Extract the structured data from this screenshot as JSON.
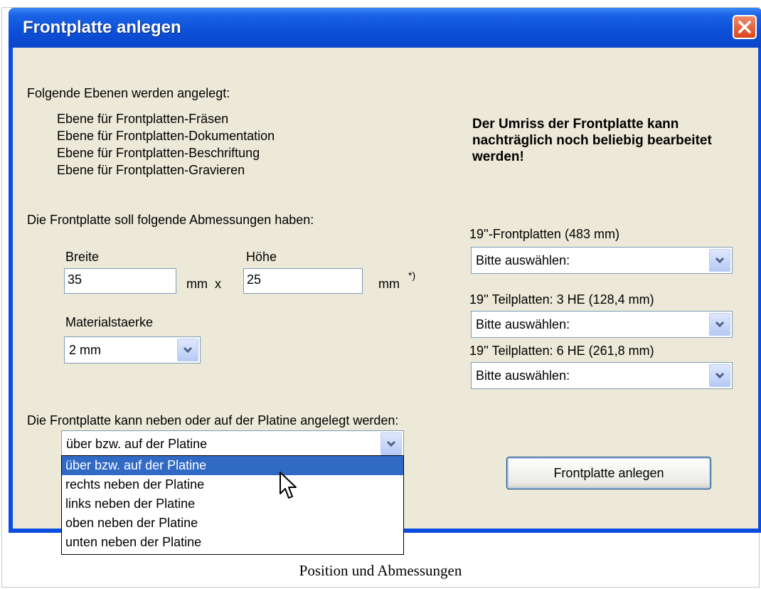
{
  "window": {
    "title": "Frontplatte anlegen"
  },
  "layers": {
    "heading": "Folgende Ebenen werden angelegt:",
    "items": [
      "Ebene für Frontplatten-Fräsen",
      "Ebene für Frontplatten-Dokumentation",
      "Ebene für Frontplatten-Beschriftung",
      "Ebene für Frontplatten-Gravieren"
    ]
  },
  "note": "Der Umriss der Frontplatte kann nachträglich noch beliebig bearbeitet werden!",
  "dimensions": {
    "heading": "Die Frontplatte soll folgende Abmessungen haben:",
    "width_label": "Breite",
    "width_value": "35",
    "height_label": "Höhe",
    "height_value": "25",
    "unit_mm_x": "mm  x",
    "unit_mm": "mm",
    "footnote_marker": "*)",
    "material_label": "Materialstaerke",
    "material_value": "2 mm"
  },
  "presets": {
    "p19_label": "19''-Frontplatten (483 mm)",
    "p19_value": "Bitte auswählen:",
    "t3_label": "19'' Teilplatten: 3 HE (128,4 mm)",
    "t3_value": "Bitte auswählen:",
    "t6_label": "19'' Teilplatten: 6 HE (261,8 mm)",
    "t6_value": "Bitte auswählen:"
  },
  "position": {
    "heading": "Die Frontplatte kann neben oder auf der Platine angelegt werden:",
    "selected": "über bzw. auf der Platine",
    "options": [
      "über bzw. auf der Platine",
      "rechts neben der Platine",
      "links neben der Platine",
      "oben neben der Platine",
      "unten neben der Platine"
    ]
  },
  "actions": {
    "create_label": "Frontplatte anlegen"
  },
  "caption": "Position und Abmessungen",
  "colors": {
    "titlebar": "#0a4ee0",
    "client_bg": "#ece9d8",
    "selection": "#316ac5",
    "close": "#d9441c"
  }
}
